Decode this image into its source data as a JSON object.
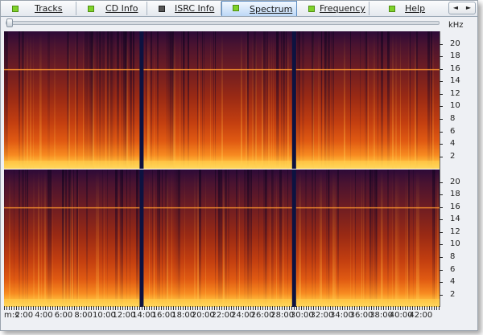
{
  "tabs": [
    {
      "label": "Tracks",
      "icon": "track-icon",
      "active": false
    },
    {
      "label": "CD Info",
      "icon": "disc-info-icon",
      "active": false
    },
    {
      "label": "ISRC Info",
      "icon": "isrc-icon",
      "active": false
    },
    {
      "label": "Spectrum",
      "icon": "spectrum-icon",
      "active": true
    },
    {
      "label": "Frequency",
      "icon": "frequency-icon",
      "active": false
    },
    {
      "label": "Help",
      "icon": "help-icon",
      "active": false
    }
  ],
  "tab_nav": {
    "prev": "◄",
    "next": "►"
  },
  "freq_axis": {
    "unit": "kHz",
    "labels": [
      "20",
      "18",
      "16",
      "14",
      "12",
      "10",
      "8",
      "6",
      "4",
      "2"
    ],
    "values": [
      20,
      18,
      16,
      14,
      12,
      10,
      8,
      6,
      4,
      2
    ],
    "max": 22.05
  },
  "time_axis": {
    "prefix": "m:s",
    "labels": [
      "2:00",
      "4:00",
      "6:00",
      "8:00",
      "10:00",
      "12:00",
      "14:00",
      "16:00",
      "18:00",
      "20:00",
      "22:00",
      "24:00",
      "26:00",
      "28:00",
      "30:00",
      "32:00",
      "34:00",
      "36:00",
      "38:00",
      "40:00",
      "42:00"
    ],
    "values_min": [
      2,
      4,
      6,
      8,
      10,
      12,
      14,
      16,
      18,
      20,
      22,
      24,
      26,
      28,
      30,
      32,
      34,
      36,
      38,
      40,
      42
    ],
    "range_min": [
      0,
      44
    ],
    "track_boundaries_min": [
      13.9,
      29.3
    ]
  },
  "channels": [
    "upper",
    "lower"
  ],
  "colors": {
    "accent": "#5f8fc4",
    "spectrum_low": "#1a0a3a",
    "spectrum_mid": "#c03810",
    "spectrum_high": "#ffd048",
    "track_gap": "#0d1240"
  }
}
